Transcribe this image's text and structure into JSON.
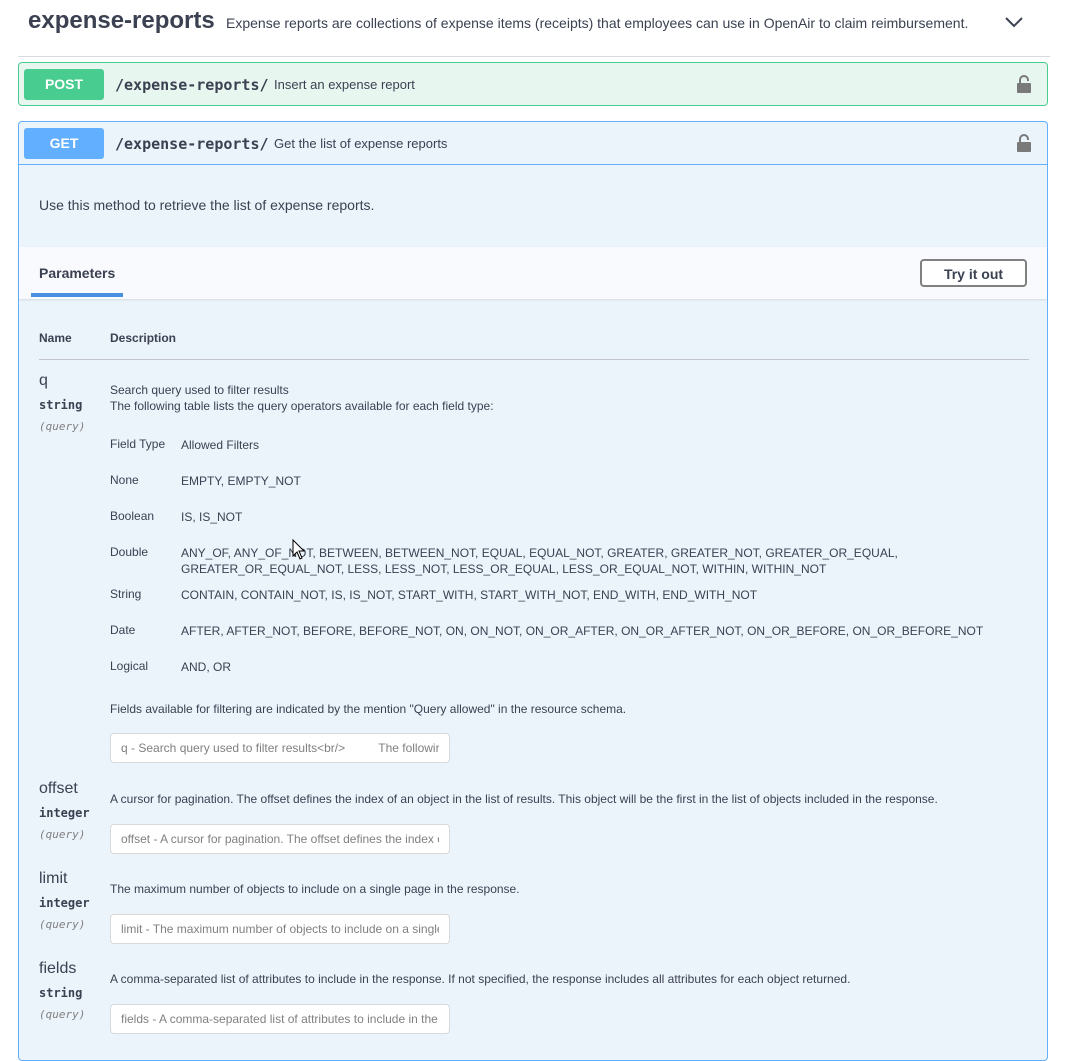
{
  "tag": {
    "title": "expense-reports",
    "description": "Expense reports are collections of expense items (receipts) that employees can use in OpenAir to claim reimbursement.",
    "chevron_icon": "chevron-down-icon"
  },
  "post_op": {
    "method": "POST",
    "path": "/expense-reports/",
    "summary": "Insert an expense report",
    "lock_icon": "lock-icon",
    "color": "#49cc90"
  },
  "get_op": {
    "method": "GET",
    "path": "/expense-reports/",
    "summary": "Get the list of expense reports",
    "lock_icon": "lock-icon",
    "color": "#61affe",
    "description": "Use this method to retrieve the list of expense reports.",
    "tab_label": "Parameters",
    "try_label": "Try it out",
    "headers": {
      "name": "Name",
      "description": "Description"
    },
    "params": [
      {
        "name": "q",
        "type": "string",
        "in": "(query)",
        "description_line1": "Search query used to filter results",
        "description_line2": "The following table lists the query operators available for each field type:",
        "filter_table": {
          "header_type": "Field Type",
          "header_filters": "Allowed Filters",
          "rows": [
            {
              "type": "None",
              "filters": "EMPTY, EMPTY_NOT"
            },
            {
              "type": "Boolean",
              "filters": "IS, IS_NOT"
            },
            {
              "type": "Double",
              "filters": "ANY_OF, ANY_OF_NOT, BETWEEN, BETWEEN_NOT, EQUAL, EQUAL_NOT, GREATER, GREATER_NOT, GREATER_OR_EQUAL, GREATER_OR_EQUAL_NOT, LESS, LESS_NOT, LESS_OR_EQUAL, LESS_OR_EQUAL_NOT, WITHIN, WITHIN_NOT"
            },
            {
              "type": "String",
              "filters": "CONTAIN, CONTAIN_NOT, IS, IS_NOT, START_WITH, START_WITH_NOT, END_WITH, END_WITH_NOT"
            },
            {
              "type": "Date",
              "filters": "AFTER, AFTER_NOT, BEFORE, BEFORE_NOT, ON, ON_NOT, ON_OR_AFTER, ON_OR_AFTER_NOT, ON_OR_BEFORE, ON_OR_BEFORE_NOT"
            },
            {
              "type": "Logical",
              "filters": "AND, OR"
            }
          ]
        },
        "note": "Fields available for filtering are indicated by the mention \"Query allowed\" in the resource schema.",
        "placeholder": "q - Search query used to filter results<br/>          The followir"
      },
      {
        "name": "offset",
        "type": "integer",
        "in": "(query)",
        "description": "A cursor for pagination. The offset defines the index of an object in the list of results. This object will be the first in the list of objects included in the response.",
        "placeholder": "offset - A cursor for pagination. The offset defines the index of"
      },
      {
        "name": "limit",
        "type": "integer",
        "in": "(query)",
        "description": "The maximum number of objects to include on a single page in the response.",
        "placeholder": "limit - The maximum number of objects to include on a single"
      },
      {
        "name": "fields",
        "type": "string",
        "in": "(query)",
        "description": "A comma-separated list of attributes to include in the response. If not specified, the response includes all attributes for each object returned.",
        "placeholder": "fields - A comma-separated list of attributes to include in the r"
      }
    ]
  }
}
